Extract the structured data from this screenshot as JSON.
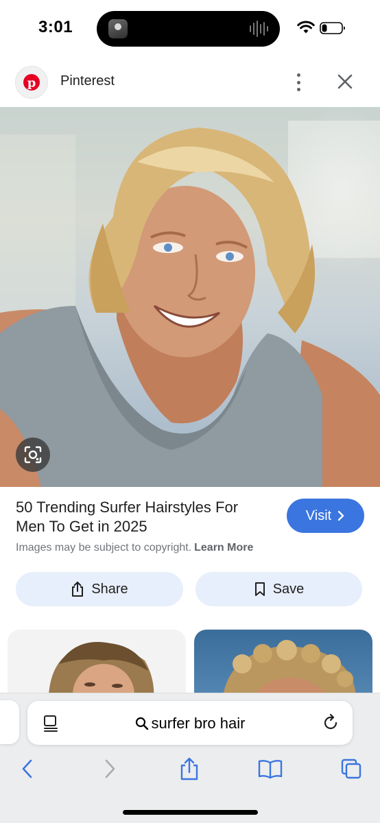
{
  "status_bar": {
    "time": "3:01"
  },
  "site": {
    "name": "Pinterest"
  },
  "result": {
    "title": "50 Trending Surfer Hairstyles For Men To Get in 2025",
    "visit_label": "Visit",
    "copyright": "Images may be subject to copyright.",
    "learn_more": "Learn More",
    "share_label": "Share",
    "save_label": "Save"
  },
  "browser": {
    "search_text": "surfer bro hair"
  },
  "colors": {
    "accent": "#3a75e0",
    "pinterest_red": "#e60023",
    "chip_bg": "#e7effc"
  },
  "icons": [
    "pinterest-logo-icon",
    "more-vert-icon",
    "close-icon",
    "lens-icon",
    "chevron-right-icon",
    "share-icon",
    "bookmark-icon",
    "reader-icon",
    "search-icon",
    "reload-icon",
    "back-icon",
    "forward-icon",
    "share-sheet-icon",
    "bookmarks-icon",
    "tabs-icon",
    "wifi-icon",
    "battery-icon"
  ]
}
